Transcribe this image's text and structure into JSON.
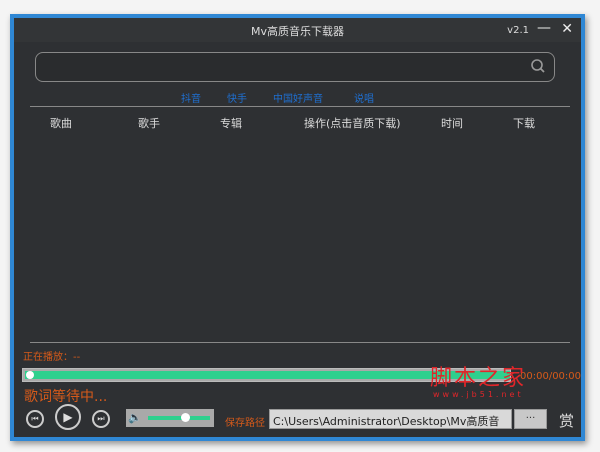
{
  "window": {
    "title": "Mv高质音乐下载器",
    "version": "v2.1",
    "minimize": "—",
    "close": "✕"
  },
  "search": {
    "value": "",
    "placeholder": "",
    "icon": "search-icon"
  },
  "tabs": [
    {
      "label": "抖音"
    },
    {
      "label": "快手"
    },
    {
      "label": "中国好声音"
    },
    {
      "label": "说唱"
    }
  ],
  "table": {
    "columns": [
      "歌曲",
      "歌手",
      "专辑",
      "操作(点击音质下载)",
      "时间",
      "下载"
    ],
    "rows": []
  },
  "player": {
    "now_playing": "正在播放：--",
    "progress_percent": 0,
    "buffered_percent": 100,
    "time": "00:00/00:00",
    "lyric": "歌词等待中...",
    "volume_percent": 60,
    "accent": "#2ed08e",
    "text_accent": "#d65a1a"
  },
  "save": {
    "label": "保存路径",
    "path": "C:\\Users\\Administrator\\Desktop\\Mv高质音",
    "browse": "...",
    "reward": "赏"
  },
  "watermark": {
    "text": "脚本之家",
    "url": "www.jb51.net"
  }
}
